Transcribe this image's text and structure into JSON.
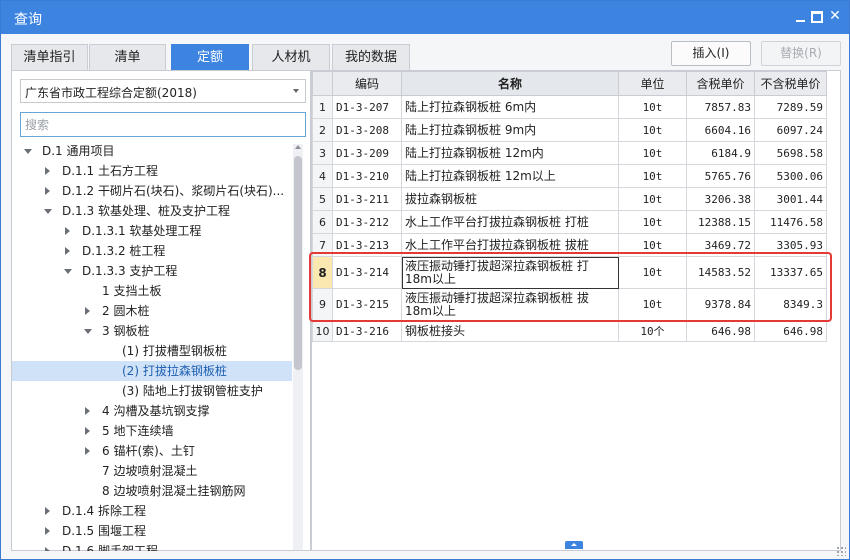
{
  "window": {
    "title": "查询",
    "close": "✕"
  },
  "tabs": [
    "清单指引",
    "清单",
    "定额",
    "人材机",
    "我的数据"
  ],
  "active_tab": 2,
  "buttons": {
    "insert": "插入(I)",
    "replace": "替换(R)"
  },
  "left": {
    "library": "广东省市政工程综合定额(2018)",
    "search_placeholder": "搜索",
    "tree": [
      {
        "label": "D.1 通用项目",
        "level": 0,
        "state": "open"
      },
      {
        "label": "D.1.1 土石方工程",
        "level": 1,
        "state": "closed"
      },
      {
        "label": "D.1.2 干砌片石(块石)、浆砌片石(块石)...",
        "level": 1,
        "state": "closed"
      },
      {
        "label": "D.1.3 软基处理、桩及支护工程",
        "level": 1,
        "state": "open"
      },
      {
        "label": "D.1.3.1 软基处理工程",
        "level": 2,
        "state": "closed"
      },
      {
        "label": "D.1.3.2 桩工程",
        "level": 2,
        "state": "closed"
      },
      {
        "label": "D.1.3.3 支护工程",
        "level": 2,
        "state": "open"
      },
      {
        "label": "1 支挡土板",
        "level": 3,
        "state": "leaf"
      },
      {
        "label": "2 圆木桩",
        "level": 3,
        "state": "closed"
      },
      {
        "label": "3 钢板桩",
        "level": 3,
        "state": "open"
      },
      {
        "label": "(1) 打拔槽型钢板桩",
        "level": 4,
        "state": "leaf"
      },
      {
        "label": "(2) 打拔拉森钢板桩",
        "level": 4,
        "state": "selected"
      },
      {
        "label": "(3) 陆地上打拔钢管桩支护",
        "level": 4,
        "state": "leaf"
      },
      {
        "label": "4 沟槽及基坑钢支撑",
        "level": 3,
        "state": "closed"
      },
      {
        "label": "5 地下连续墙",
        "level": 3,
        "state": "closed"
      },
      {
        "label": "6 锚杆(索)、土钉",
        "level": 3,
        "state": "closed"
      },
      {
        "label": "7 边坡喷射混凝土",
        "level": 3,
        "state": "leaf"
      },
      {
        "label": "8 边坡喷射混凝土挂钢筋网",
        "level": 3,
        "state": "leaf"
      },
      {
        "label": "D.1.4 拆除工程",
        "level": 1,
        "state": "closed"
      },
      {
        "label": "D.1.5 围堰工程",
        "level": 1,
        "state": "closed"
      },
      {
        "label": "D.1.6 脚手架工程",
        "level": 1,
        "state": "closed"
      }
    ]
  },
  "table": {
    "headers": [
      "",
      "编码",
      "名称",
      "单位",
      "含税单价",
      "不含税单价"
    ],
    "rows": [
      {
        "idx": "1",
        "code": "D1-3-207",
        "name": "陆上打拉森钢板桩 6m内",
        "unit": "10t",
        "tax": "7857.83",
        "notax": "7289.59"
      },
      {
        "idx": "2",
        "code": "D1-3-208",
        "name": "陆上打拉森钢板桩 9m内",
        "unit": "10t",
        "tax": "6604.16",
        "notax": "6097.24"
      },
      {
        "idx": "3",
        "code": "D1-3-209",
        "name": "陆上打拉森钢板桩 12m内",
        "unit": "10t",
        "tax": "6184.9",
        "notax": "5698.58"
      },
      {
        "idx": "4",
        "code": "D1-3-210",
        "name": "陆上打拉森钢板桩 12m以上",
        "unit": "10t",
        "tax": "5765.76",
        "notax": "5300.06"
      },
      {
        "idx": "5",
        "code": "D1-3-211",
        "name": "拔拉森钢板桩",
        "unit": "10t",
        "tax": "3206.38",
        "notax": "3001.44"
      },
      {
        "idx": "6",
        "code": "D1-3-212",
        "name": "水上工作平台打拔拉森钢板桩 打桩",
        "unit": "10t",
        "tax": "12388.15",
        "notax": "11476.58"
      },
      {
        "idx": "7",
        "code": "D1-3-213",
        "name": "水上工作平台打拔拉森钢板桩 拔桩",
        "unit": "10t",
        "tax": "3469.72",
        "notax": "3305.93"
      },
      {
        "idx": "8",
        "code": "D1-3-214",
        "name": "液压振动锤打拔超深拉森钢板桩 打18m以上",
        "unit": "10t",
        "tax": "14583.52",
        "notax": "13337.65"
      },
      {
        "idx": "9",
        "code": "D1-3-215",
        "name": "液压振动锤打拔超深拉森钢板桩 拔18m以上",
        "unit": "10t",
        "tax": "9378.84",
        "notax": "8349.3"
      },
      {
        "idx": "10",
        "code": "D1-3-216",
        "name": "钢板桩接头",
        "unit": "10个",
        "tax": "646.98",
        "notax": "646.98"
      }
    ],
    "active_row": 7
  }
}
